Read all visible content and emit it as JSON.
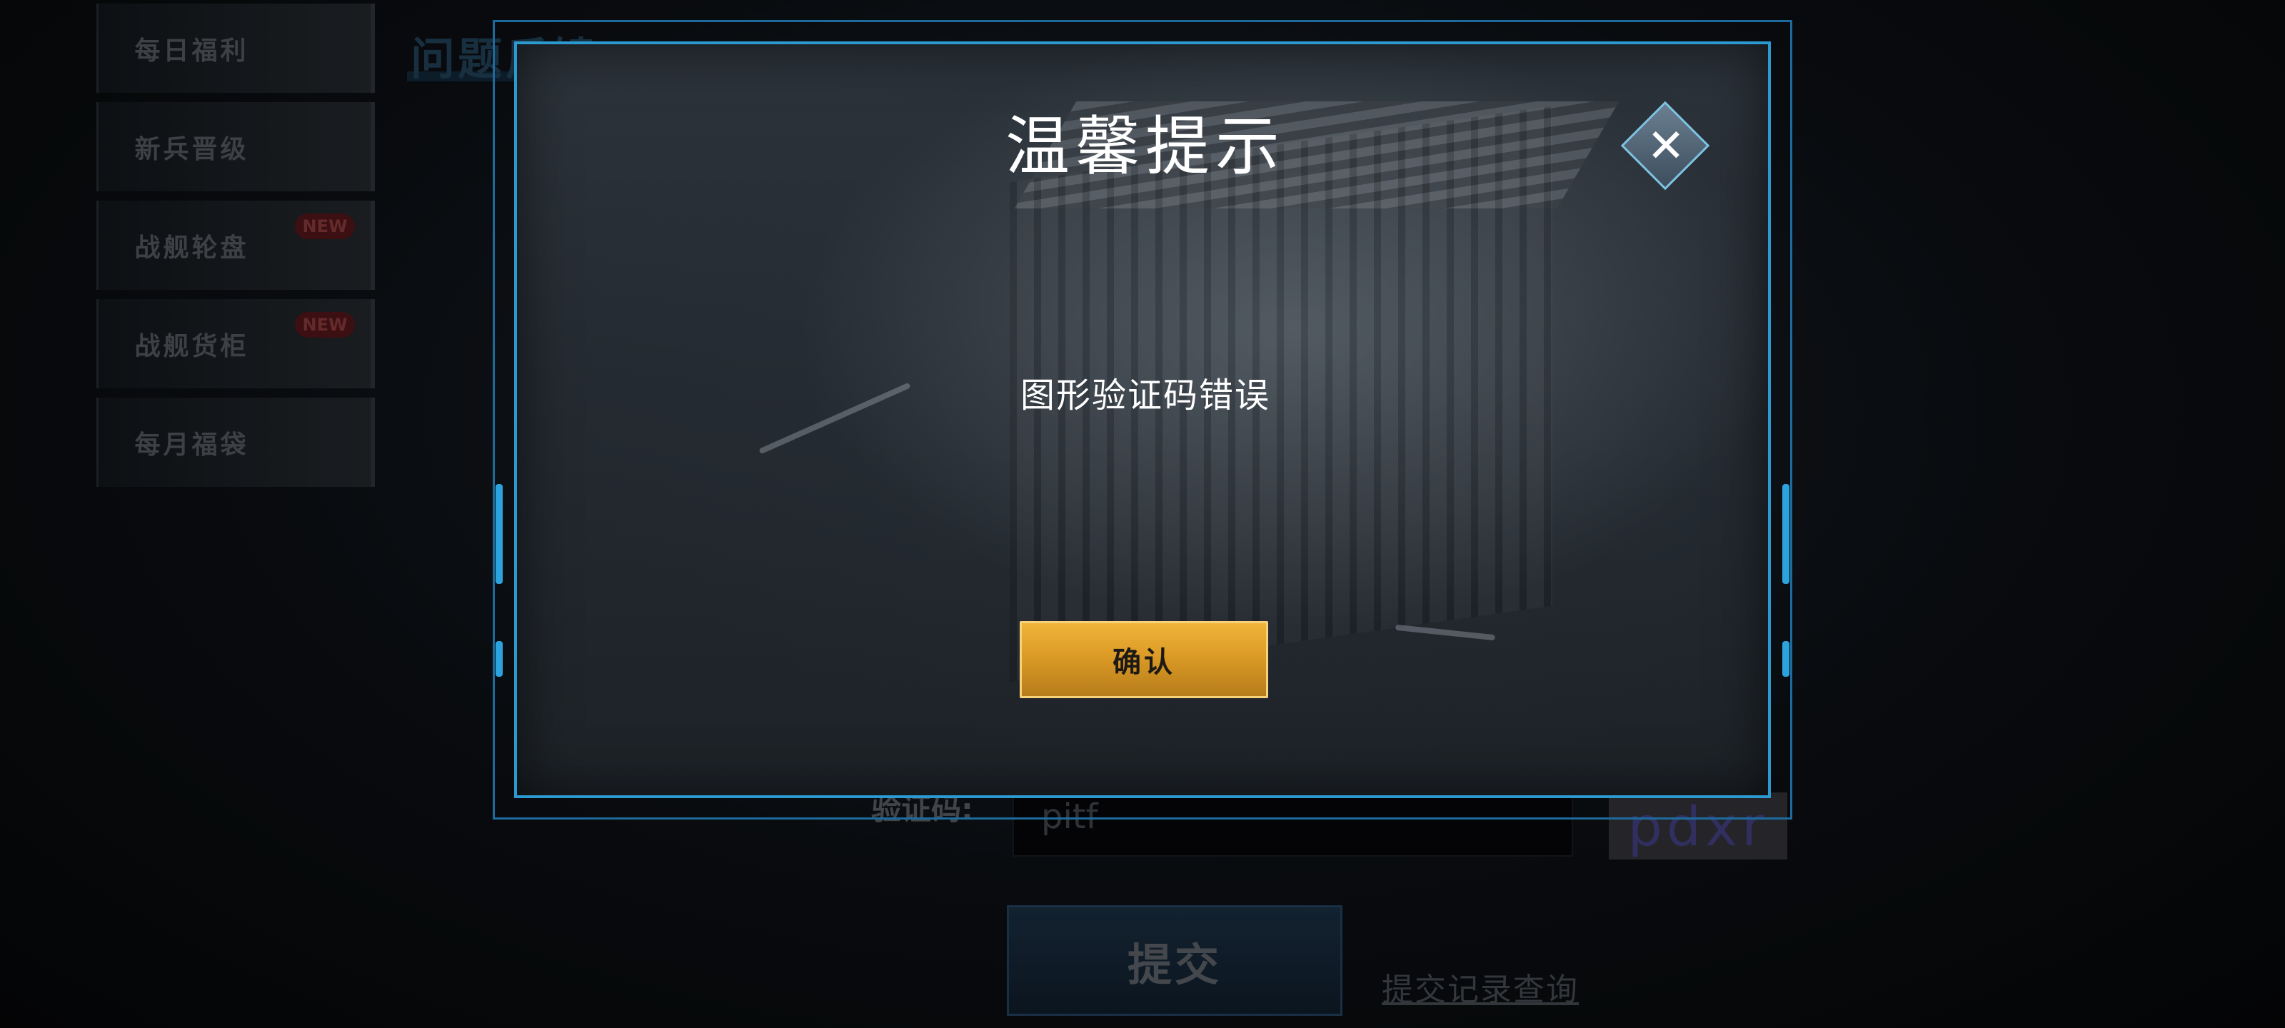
{
  "sidebar": {
    "items": [
      {
        "label": "每日福利",
        "badge": ""
      },
      {
        "label": "新兵晋级",
        "badge": ""
      },
      {
        "label": "战舰轮盘",
        "badge": "NEW"
      },
      {
        "label": "战舰货柜",
        "badge": "NEW"
      },
      {
        "label": "每月福袋",
        "badge": ""
      }
    ]
  },
  "background": {
    "page_title": "问题反馈",
    "captcha_label": "验证码:",
    "captcha_input_value": "pitf",
    "captcha_image_text": "pdxr",
    "submit_label": "提交",
    "record_link": "提交记录查询"
  },
  "dialog": {
    "title": "温馨提示",
    "message": "图形验证码错误",
    "confirm_label": "确认",
    "close_icon": "close-icon"
  },
  "colors": {
    "frame_accent": "#2b9ad0",
    "confirm_button": "#dc9b26",
    "badge_new": "#4a1416"
  }
}
